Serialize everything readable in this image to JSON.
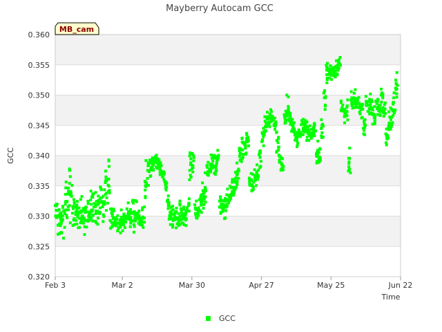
{
  "chart_data": {
    "type": "scatter",
    "title": "Mayberry Autocam GCC",
    "xlabel": "Time",
    "ylabel": "GCC",
    "tag": "MB_cam",
    "ylim": [
      0.32,
      0.36
    ],
    "y_ticks": [
      "0.320",
      "0.325",
      "0.330",
      "0.335",
      "0.340",
      "0.345",
      "0.350",
      "0.355",
      "0.360"
    ],
    "x_range_days": [
      0,
      139
    ],
    "x_ticks": [
      {
        "label": "Feb 3",
        "day": 0
      },
      {
        "label": "Mar 2",
        "day": 27
      },
      {
        "label": "Mar 30",
        "day": 55
      },
      {
        "label": "Apr 27",
        "day": 83
      },
      {
        "label": "May 25",
        "day": 111
      },
      {
        "label": "Jun 22",
        "day": 139
      }
    ],
    "grid": true,
    "legend_position": "bottom-center",
    "colors": {
      "series": "#00ff00",
      "band": "#f2f2f2",
      "grid": "#dddddd",
      "tag_fill": "#ffffcc"
    },
    "series": [
      {
        "name": "GCC",
        "color": "#00ff00",
        "daily_ranges": [
          [
            0.327,
            0.334
          ],
          [
            0.326,
            0.333
          ],
          [
            0.325,
            0.334
          ],
          [
            0.325,
            0.336
          ],
          [
            0.327,
            0.338
          ],
          [
            0.328,
            0.34
          ],
          [
            0.326,
            0.338
          ],
          [
            0.326,
            0.335
          ],
          [
            0.327,
            0.334
          ],
          [
            0.327,
            0.333
          ],
          [
            0.326,
            0.334
          ],
          [
            0.326,
            0.334
          ],
          [
            0.326,
            0.335
          ],
          [
            0.326,
            0.334
          ],
          [
            0.326,
            0.336
          ],
          [
            0.327,
            0.337
          ],
          [
            0.327,
            0.335
          ],
          [
            0.328,
            0.335
          ],
          [
            0.328,
            0.337
          ],
          [
            0.328,
            0.338
          ],
          [
            0.33,
            0.34
          ],
          [
            0.331,
            0.343
          ],
          [
            0.327,
            0.333
          ],
          [
            0.327,
            0.332
          ],
          [
            0.327,
            0.332
          ],
          [
            0.326,
            0.331
          ],
          [
            0.326,
            0.332
          ],
          [
            0.326,
            0.333
          ],
          [
            0.327,
            0.332
          ],
          [
            0.327,
            0.333
          ],
          [
            0.327,
            0.333
          ],
          [
            0.326,
            0.336
          ],
          [
            0.327,
            0.334
          ],
          [
            0.327,
            0.333
          ],
          [
            0.326,
            0.332
          ],
          [
            0.327,
            0.332
          ],
          [
            0.331,
            0.341
          ],
          [
            0.334,
            0.342
          ],
          [
            0.335,
            0.341
          ],
          [
            0.336,
            0.341
          ],
          [
            0.337,
            0.341
          ],
          [
            0.337,
            0.341
          ],
          [
            0.336,
            0.339
          ],
          [
            0.335,
            0.338
          ],
          [
            0.333,
            0.337
          ],
          [
            0.329,
            0.335
          ],
          [
            0.327,
            0.333
          ],
          [
            0.327,
            0.333
          ],
          [
            0.327,
            0.332
          ],
          [
            0.327,
            0.333
          ],
          [
            0.328,
            0.333
          ],
          [
            0.327,
            0.333
          ],
          [
            0.328,
            0.333
          ],
          [
            0.329,
            0.334
          ],
          [
            0.334,
            0.342
          ],
          [
            0.336,
            0.342
          ],
          [
            0.329,
            0.333
          ],
          [
            0.329,
            0.333
          ],
          [
            0.33,
            0.335
          ],
          [
            0.33,
            0.336
          ],
          [
            0.331,
            0.338
          ],
          [
            0.334,
            0.34
          ],
          [
            0.335,
            0.341
          ],
          [
            0.336,
            0.342
          ],
          [
            0.335,
            0.342
          ],
          [
            0.336,
            0.343
          ],
          [
            0.33,
            0.334
          ],
          [
            0.33,
            0.334
          ],
          [
            0.329,
            0.334
          ],
          [
            0.33,
            0.335
          ],
          [
            0.331,
            0.336
          ],
          [
            0.332,
            0.337
          ],
          [
            0.333,
            0.338
          ],
          [
            0.334,
            0.34
          ],
          [
            0.337,
            0.343
          ],
          [
            0.338,
            0.344
          ],
          [
            0.339,
            0.344
          ],
          [
            0.341,
            0.345
          ],
          [
            0.334,
            0.338
          ],
          [
            0.333,
            0.338
          ],
          [
            0.333,
            0.339
          ],
          [
            0.334,
            0.34
          ],
          [
            0.337,
            0.343
          ],
          [
            0.34,
            0.345
          ],
          [
            0.342,
            0.347
          ],
          [
            0.343,
            0.348
          ],
          [
            0.344,
            0.348
          ],
          [
            0.344,
            0.348
          ],
          [
            0.344,
            0.347
          ],
          [
            0.34,
            0.345
          ],
          [
            0.337,
            0.342
          ],
          [
            0.336,
            0.341
          ],
          [
            0.344,
            0.349
          ],
          [
            0.345,
            0.351
          ],
          [
            0.344,
            0.348
          ],
          [
            0.343,
            0.347
          ],
          [
            0.342,
            0.346
          ],
          [
            0.341,
            0.345
          ],
          [
            0.342,
            0.345
          ],
          [
            0.343,
            0.347
          ],
          [
            0.343,
            0.347
          ],
          [
            0.342,
            0.346
          ],
          [
            0.341,
            0.346
          ],
          [
            0.342,
            0.346
          ],
          [
            0.343,
            0.347
          ],
          [
            0.338,
            0.343
          ],
          [
            0.338,
            0.342
          ],
          [
            0.341,
            0.347
          ],
          [
            0.346,
            0.352
          ],
          [
            0.351,
            0.357
          ],
          [
            0.352,
            0.357
          ],
          [
            0.352,
            0.356
          ],
          [
            0.352,
            0.356
          ],
          [
            0.352,
            0.356
          ],
          [
            0.353,
            0.357
          ],
          [
            0.346,
            0.35
          ],
          [
            0.345,
            0.349
          ],
          [
            0.344,
            0.35
          ],
          [
            0.336,
            0.342
          ],
          [
            0.346,
            0.352
          ],
          [
            0.347,
            0.352
          ],
          [
            0.346,
            0.351
          ],
          [
            0.346,
            0.35
          ],
          [
            0.345,
            0.35
          ],
          [
            0.341,
            0.348
          ],
          [
            0.346,
            0.351
          ],
          [
            0.345,
            0.351
          ],
          [
            0.345,
            0.35
          ],
          [
            0.344,
            0.349
          ],
          [
            0.346,
            0.351
          ],
          [
            0.345,
            0.35
          ],
          [
            0.346,
            0.352
          ],
          [
            0.345,
            0.35
          ],
          [
            0.34,
            0.345
          ],
          [
            0.342,
            0.348
          ],
          [
            0.343,
            0.349
          ],
          [
            0.345,
            0.352
          ],
          [
            0.348,
            0.354
          ]
        ]
      }
    ]
  }
}
